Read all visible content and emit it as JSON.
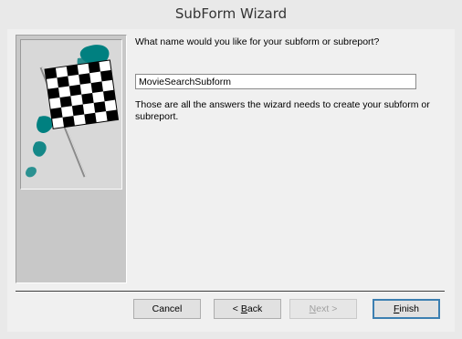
{
  "window": {
    "title": "SubForm Wizard"
  },
  "main": {
    "question": "What name would you like for your subform or subreport?",
    "name_value": "MovieSearchSubform",
    "info": "Those are all the answers the wizard needs to create your subform or subreport."
  },
  "buttons": {
    "cancel": "Cancel",
    "back_prefix": "< ",
    "back_accel": "B",
    "back_suffix": "ack",
    "next_prefix": "",
    "next_accel": "N",
    "next_suffix": "ext >",
    "finish_accel": "F",
    "finish_suffix": "inish"
  },
  "illustration": {
    "icon": "checkered-flag-icon",
    "accent": "#008080"
  }
}
